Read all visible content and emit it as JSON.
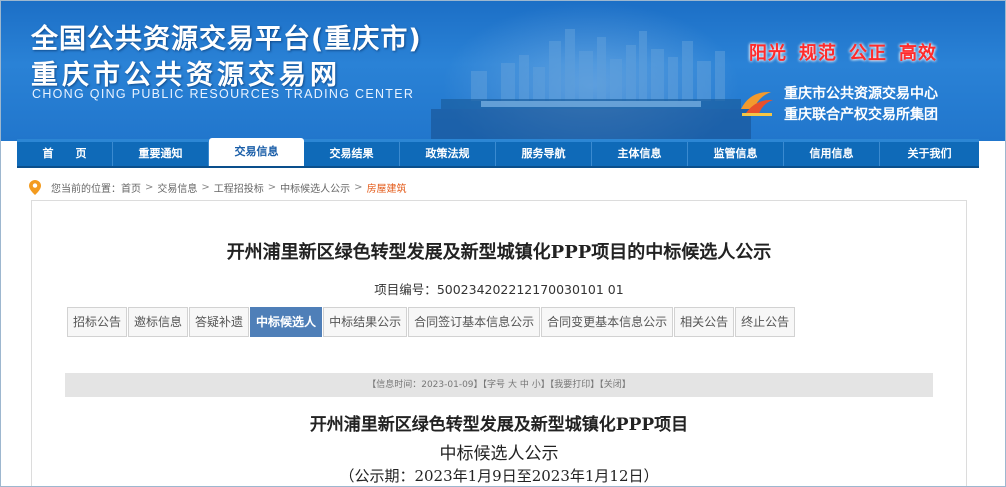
{
  "header": {
    "title_line1": "全国公共资源交易平台(重庆市)",
    "title_line2": "重庆市公共资源交易网",
    "title_en": "CHONG QING PUBLIC RESOURCES TRADING CENTER",
    "slogans": [
      "阳光",
      "规范",
      "公正",
      "高效"
    ],
    "org_line1": "重庆市公共资源交易中心",
    "org_line2": "重庆联合产权交易所集团",
    "slogan_color": "#ff2b2b",
    "brand_color": "#1c6fc6"
  },
  "nav": {
    "items": [
      "首　　页",
      "重要通知",
      "交易信息",
      "交易结果",
      "政策法规",
      "服务导航",
      "主体信息",
      "监管信息",
      "信用信息",
      "关于我们"
    ],
    "active_index": 2
  },
  "breadcrumb": {
    "prefix": "您当前的位置：",
    "items": [
      "首页",
      "交易信息",
      "工程招投标",
      "中标候选人公示",
      "房屋建筑"
    ],
    "separator": ">"
  },
  "article": {
    "title": "开州浦里新区绿色转型发展及新型城镇化PPP项目的中标候选人公示",
    "project_no_label": "项目编号：",
    "project_no": "500234202212170030101 01",
    "tabs": [
      "招标公告",
      "邀标信息",
      "答疑补遗",
      "中标候选人",
      "中标结果公示",
      "合同签订基本信息公示",
      "合同变更基本信息公示",
      "相关公告",
      "终止公告"
    ],
    "active_tab": 3,
    "info_bar": {
      "time_label": "【信息时间：",
      "date": "2023-01-09",
      "time_end": "】",
      "font_label": "【字号",
      "size_large": "大",
      "size_mid": "中",
      "size_small": "小",
      "font_end": "】",
      "print": "【我要打印】",
      "close": "【关闭】"
    },
    "notice_line1": "开州浦里新区绿色转型发展及新型城镇化PPP项目",
    "notice_line2": "中标候选人公示",
    "notice_period": "（公示期：2023年1月9日至2023年1月12日）"
  }
}
